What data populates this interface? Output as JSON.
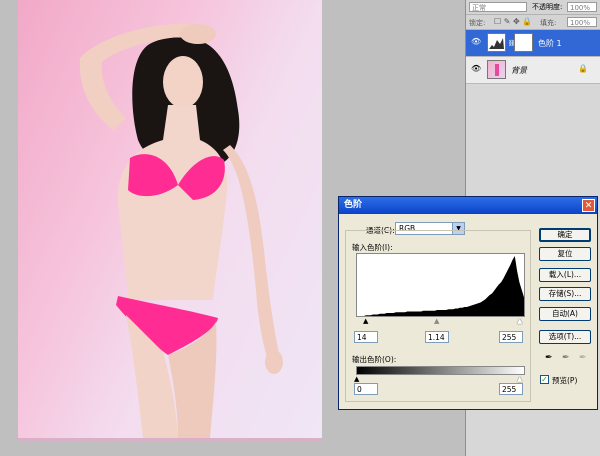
{
  "layers_panel": {
    "blend_mode": "正常",
    "opacity_label": "不透明度:",
    "opacity_value": "100%",
    "lock_label": "锁定:",
    "fill_label": "填充:",
    "fill_value": "100%",
    "layers": [
      {
        "name": "色阶 1",
        "selected": true
      },
      {
        "name": "背景",
        "selected": false
      }
    ]
  },
  "levels_dialog": {
    "title": "色阶",
    "close_glyph": "✕",
    "channel_label": "通道(C):",
    "channel_value": "RGB",
    "input_levels_label": "输入色阶(I):",
    "input_black": "14",
    "input_gamma": "1.14",
    "input_white": "255",
    "output_levels_label": "输出色阶(O):",
    "output_black": "0",
    "output_white": "255",
    "preview_label": "预览(P)",
    "preview_checked": true,
    "buttons": {
      "ok": "确定",
      "reset": "复位",
      "load": "载入(L)...",
      "save": "存储(S)...",
      "auto": "自动(A)",
      "options": "选项(T)..."
    },
    "histogram": [
      0,
      0,
      0,
      0,
      1,
      1,
      1,
      2,
      2,
      2,
      3,
      3,
      3,
      4,
      4,
      4,
      4,
      5,
      5,
      5,
      5,
      5,
      6,
      6,
      6,
      6,
      6,
      6,
      6,
      7,
      7,
      7,
      7,
      7,
      7,
      8,
      8,
      8,
      8,
      8,
      9,
      9,
      9,
      10,
      10,
      11,
      11,
      12,
      12,
      13,
      14,
      15,
      16,
      17,
      18,
      20,
      22,
      25,
      28,
      30,
      34,
      38,
      42,
      45,
      50,
      56,
      62,
      68,
      75,
      80,
      60,
      45,
      35,
      25
    ]
  }
}
